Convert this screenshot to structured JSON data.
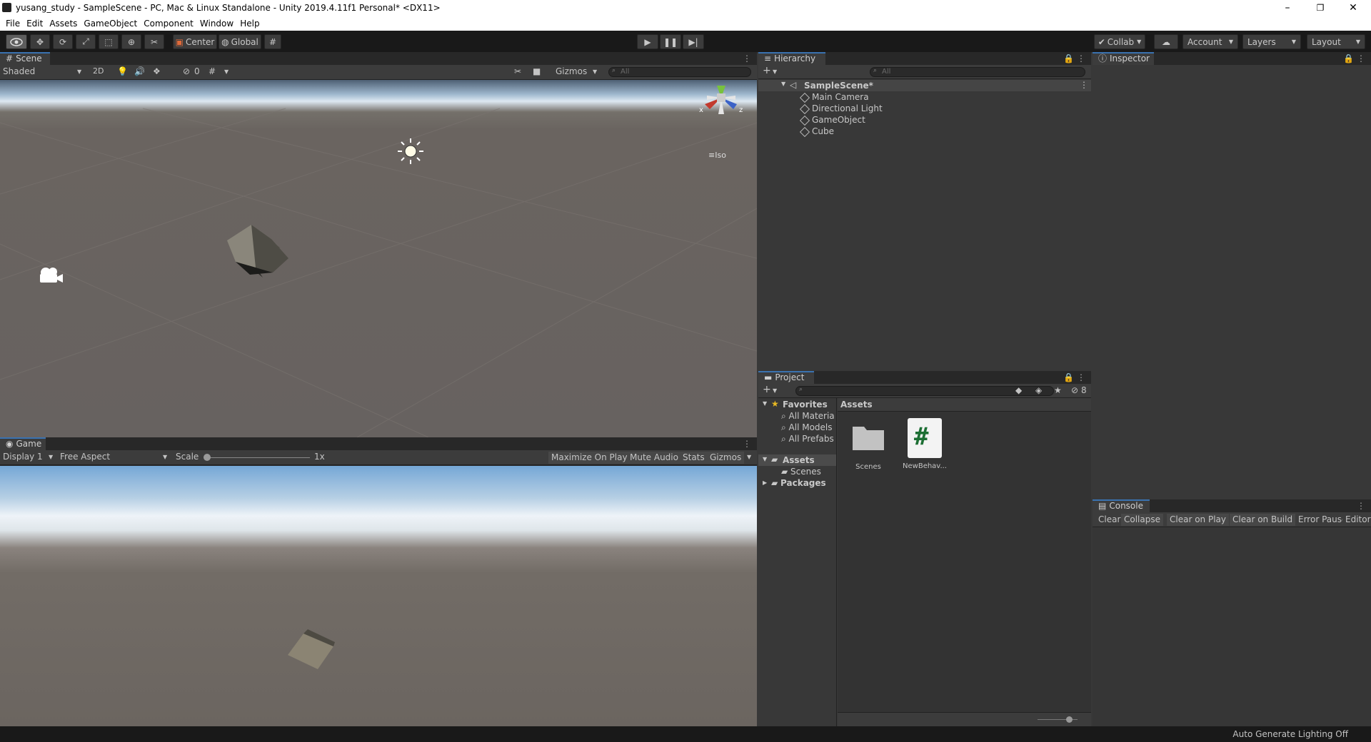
{
  "window": {
    "title": "yusang_study - SampleScene - PC, Mac & Linux Standalone - Unity 2019.4.11f1 Personal* <DX11>",
    "minimize": "–",
    "restore": "❐",
    "close": "✕"
  },
  "menu": [
    "File",
    "Edit",
    "Assets",
    "GameObject",
    "Component",
    "Window",
    "Help"
  ],
  "toolbar": {
    "pivot": "Center",
    "space": "Global",
    "collab": "Collab",
    "account": "Account",
    "layers": "Layers",
    "layout": "Layout"
  },
  "scene": {
    "tab": "Scene",
    "shading": "Shaded",
    "mode2d": "2D",
    "hidden_count": "0",
    "gizmos": "Gizmos",
    "search_placeholder": "All",
    "iso": "Iso",
    "axis_x": "x",
    "axis_z": "z"
  },
  "game": {
    "tab": "Game",
    "display": "Display 1",
    "aspect": "Free Aspect",
    "scale_label": "Scale",
    "scale_value": "1x",
    "scale_level": 0,
    "maximize": "Maximize On Play",
    "mute": "Mute Audio",
    "stats": "Stats",
    "gizmos": "Gizmos"
  },
  "hierarchy": {
    "tab": "Hierarchy",
    "search_placeholder": "All",
    "scene_name": "SampleScene*",
    "items": [
      "Main Camera",
      "Directional Light",
      "GameObject",
      "Cube"
    ]
  },
  "inspector": {
    "tab": "Inspector"
  },
  "project": {
    "tab": "Project",
    "hidden_count": "8",
    "favorites_label": "Favorites",
    "favorites": [
      "All Materia",
      "All Models",
      "All Prefabs"
    ],
    "assets_label": "Assets",
    "scenes_label": "Scenes",
    "packages_label": "Packages",
    "breadcrumb": "Assets",
    "files": [
      {
        "name": "Scenes",
        "icon": "folder-icon"
      },
      {
        "name": "NewBehav...",
        "icon": "csharp-script-icon"
      }
    ]
  },
  "console": {
    "tab": "Console",
    "buttons": [
      "Clear",
      "Collapse",
      "Clear on Play",
      "Clear on Build",
      "Error Pause",
      "Editor"
    ]
  },
  "status": {
    "text": "Auto Generate Lighting Off"
  }
}
